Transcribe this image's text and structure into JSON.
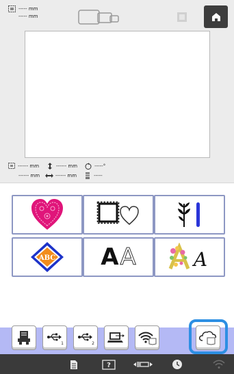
{
  "header": {
    "width_readout": "----- mm",
    "height_readout": "----- mm",
    "home_icon": "home-icon",
    "frame_icon": "frame-display-icon"
  },
  "info": {
    "size_w": "------ mm",
    "size_h": "------ mm",
    "move_v": "------ mm",
    "move_h": "------ mm",
    "rotate": "-----°",
    "thread": "-----"
  },
  "categories": [
    {
      "name": "embroidery-patterns",
      "icon": "lace-heart-icon"
    },
    {
      "name": "frame-patterns",
      "icon": "frame-heart-icon"
    },
    {
      "name": "utility-stitches",
      "icon": "leaf-stitch-icon"
    },
    {
      "name": "monogram",
      "icon": "monogram-diamond-icon",
      "text": "ABC"
    },
    {
      "name": "alphabet-fonts",
      "icon": "font-aa-icon",
      "text": "A",
      "text2": "A"
    },
    {
      "name": "decorative-alphabet",
      "icon": "floral-alphabet-icon",
      "text": "A"
    }
  ],
  "storage": [
    {
      "name": "machine-memory",
      "icon": "machine-icon"
    },
    {
      "name": "usb-1",
      "icon": "usb-icon",
      "text": "1"
    },
    {
      "name": "usb-2",
      "icon": "usb-icon",
      "text": "2"
    },
    {
      "name": "computer",
      "icon": "computer-usb-icon"
    },
    {
      "name": "wireless",
      "icon": "wifi-pocket-icon"
    },
    {
      "name": "cloud",
      "icon": "cloud-pocket-icon",
      "highlighted": true
    }
  ],
  "colors": {
    "accent": "#2d8fe3",
    "status_bar": "#3a3a3a",
    "band": "#b4b9f5",
    "button_border": "#8d97c3"
  }
}
